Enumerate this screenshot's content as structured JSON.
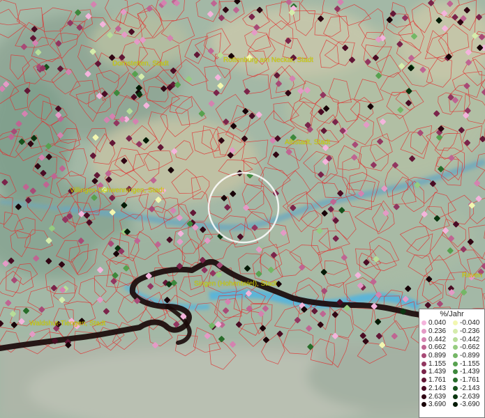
{
  "map": {
    "places": [
      {
        "id": "dornstetten",
        "label": "Dornstetten, Stadt"
      },
      {
        "id": "rottenburg",
        "label": "Rottenburg am Neckar, Stadt"
      },
      {
        "id": "albstadt",
        "label": "Albstadt, Stadt"
      },
      {
        "id": "villingen",
        "label": "Villingen-Schwenningen, Stadt"
      },
      {
        "id": "singen",
        "label": "Singen (Hohentwiel), Stadt"
      },
      {
        "id": "waldshut",
        "label": "Waldshut-Tiengen, Stadt"
      },
      {
        "id": "ravensburg",
        "label": "Raven"
      }
    ],
    "colors": {
      "district_border": "#e03030",
      "national_border": "#1a0a0a",
      "water": "#5bb7d8",
      "place_label": "#d4d400",
      "selection_ring": "#ffffff"
    }
  },
  "legend": {
    "title": "%/Jahr",
    "positive": [
      {
        "label": "0.040",
        "color": "#f4b4dc"
      },
      {
        "label": "0.236",
        "color": "#e49ac6"
      },
      {
        "label": "0.442",
        "color": "#d482b0"
      },
      {
        "label": "0.662",
        "color": "#bf6592"
      },
      {
        "label": "0.899",
        "color": "#a84a76"
      },
      {
        "label": "1.155",
        "color": "#923660"
      },
      {
        "label": "1.439",
        "color": "#7a244a"
      },
      {
        "label": "1.761",
        "color": "#621736"
      },
      {
        "label": "2.143",
        "color": "#4a0c24"
      },
      {
        "label": "2.639",
        "color": "#300613"
      },
      {
        "label": "3.690",
        "color": "#180208"
      }
    ],
    "negative": [
      {
        "label": "-0.040",
        "color": "#f2f7b0"
      },
      {
        "label": "-0.236",
        "color": "#d5ecab"
      },
      {
        "label": "-0.442",
        "color": "#b7dd98"
      },
      {
        "label": "-0.662",
        "color": "#96cc80"
      },
      {
        "label": "-0.899",
        "color": "#74b766"
      },
      {
        "label": "-1.155",
        "color": "#57a14f"
      },
      {
        "label": "-1.439",
        "color": "#3d883c"
      },
      {
        "label": "-1.761",
        "color": "#276d2a"
      },
      {
        "label": "-2.143",
        "color": "#16521c"
      },
      {
        "label": "-2.639",
        "color": "#0a3610"
      },
      {
        "label": "-3.690",
        "color": "#031a06"
      }
    ]
  }
}
